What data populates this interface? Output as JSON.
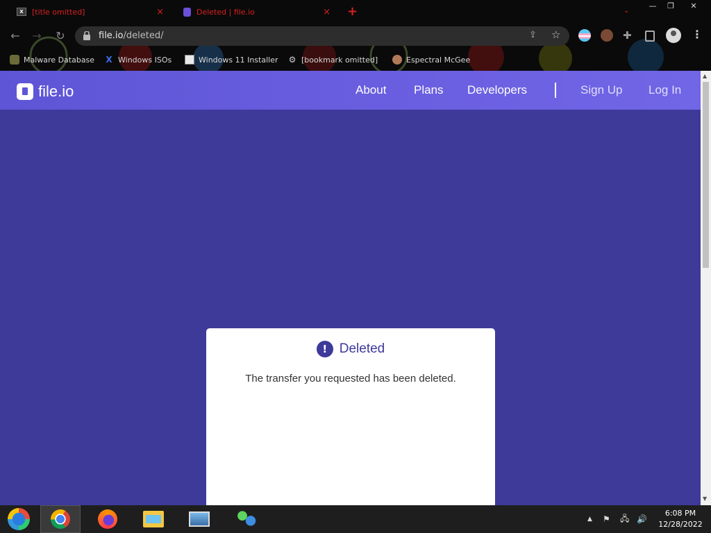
{
  "browser": {
    "tabs": [
      {
        "title": "[title omitted]",
        "close": "×"
      },
      {
        "title": "Deleted | file.io",
        "close": "×"
      }
    ],
    "new_tab": "+",
    "window_controls": {
      "minimize": "—",
      "maximize": "❐",
      "close": "✕"
    },
    "url": {
      "host": "file.io",
      "path": "/deleted/"
    },
    "bookmarks": [
      {
        "label": "Malware Database",
        "icon": "malware-db-icon"
      },
      {
        "label": "Windows ISOs",
        "icon": "windows-isos-icon"
      },
      {
        "label": "Windows 11 Installer",
        "icon": "installer-icon"
      },
      {
        "label": "[bookmark omitted]",
        "icon": "site-icon"
      },
      {
        "label": "Espectral McGee",
        "icon": "espectral-icon"
      }
    ]
  },
  "site": {
    "logo_text": "file.io",
    "nav": {
      "about": "About",
      "plans": "Plans",
      "developers": "Developers",
      "sign_up": "Sign Up",
      "log_in": "Log In"
    },
    "card": {
      "icon_glyph": "!",
      "title": "Deleted",
      "message": "The transfer you requested has been deleted."
    },
    "colors": {
      "page_bg": "#3d3a9a",
      "navbar": "#6a5fe0",
      "card_bg": "#ffffff"
    }
  },
  "taskbar": {
    "time": "6:08 PM",
    "date": "12/28/2022"
  }
}
